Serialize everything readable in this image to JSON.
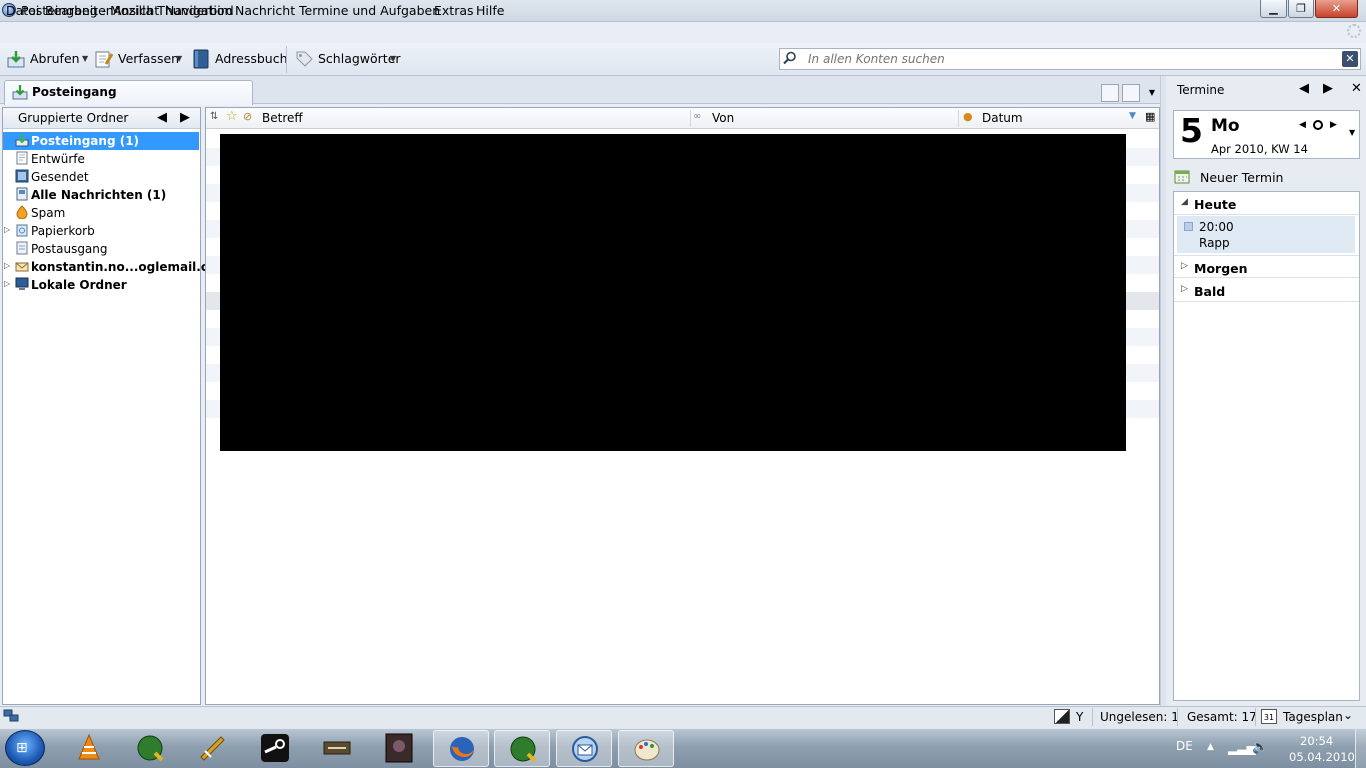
{
  "window": {
    "title": "Posteingang - Mozilla Thunderbird",
    "minimize_icon": "minimize-icon",
    "maximize_icon": "maximize-icon",
    "close_icon": "close-icon"
  },
  "menubar": [
    "Datei",
    "Bearbeiten",
    "Ansicht",
    "Navigation",
    "Nachricht",
    "Termine und Aufgaben",
    "Extras",
    "Hilfe"
  ],
  "toolbar": {
    "get_mail": "Abrufen",
    "compose": "Verfassen",
    "address_book": "Adressbuch",
    "tags": "Schlagwörter"
  },
  "search": {
    "placeholder": "In allen Konten suchen"
  },
  "tabs": [
    {
      "label": "Posteingang",
      "icon": "inbox-icon"
    }
  ],
  "folder_pane": {
    "header": "Gruppierte Ordner",
    "folders": [
      {
        "name": "Posteingang (1)",
        "icon": "inbox-icon",
        "selected": true,
        "bold": true
      },
      {
        "name": "Entwürfe",
        "icon": "drafts-icon"
      },
      {
        "name": "Gesendet",
        "icon": "sent-icon"
      },
      {
        "name": "Alle Nachrichten (1)",
        "icon": "all-messages-icon",
        "bold": true
      },
      {
        "name": "Spam",
        "icon": "spam-icon"
      },
      {
        "name": "Papierkorb",
        "icon": "trash-icon",
        "expandable": true
      },
      {
        "name": "Postausgang",
        "icon": "outbox-icon"
      },
      {
        "name": "konstantin.no...oglemail.com",
        "icon": "account-icon",
        "expandable": true,
        "bold": true
      },
      {
        "name": "Lokale Ordner",
        "icon": "local-folders-icon",
        "expandable": true,
        "bold": true
      }
    ]
  },
  "thread_pane": {
    "columns": [
      "Betreff",
      "Von",
      "Datum"
    ]
  },
  "today_pane": {
    "title": "Termine",
    "day": "5",
    "weekday": "Mo",
    "month_week": "Apr 2010, KW 14",
    "new_event": "Neuer Termin",
    "sections": [
      "Heute",
      "Morgen",
      "Bald"
    ],
    "event": {
      "time": "20:00",
      "title": "Rapp"
    }
  },
  "statusbar": {
    "y_label": "Y",
    "unread": "Ungelesen: 1",
    "total": "Gesamt: 17",
    "view": "Tagesplan",
    "view_day_number": "31"
  },
  "taskbar": {
    "apps": [
      "vlc-icon",
      "quintessential-icon",
      "app-icon",
      "steam-icon",
      "battlefield-icon",
      "game-icon",
      "firefox-icon",
      "quintessential-icon",
      "thunderbird-icon",
      "paint-icon"
    ],
    "language": "DE",
    "time": "20:54",
    "date": "05.04.2010"
  },
  "colors": {
    "selection": "#3399ff",
    "chrome": "#e9eef6",
    "taskbar": "#8e9faf"
  }
}
